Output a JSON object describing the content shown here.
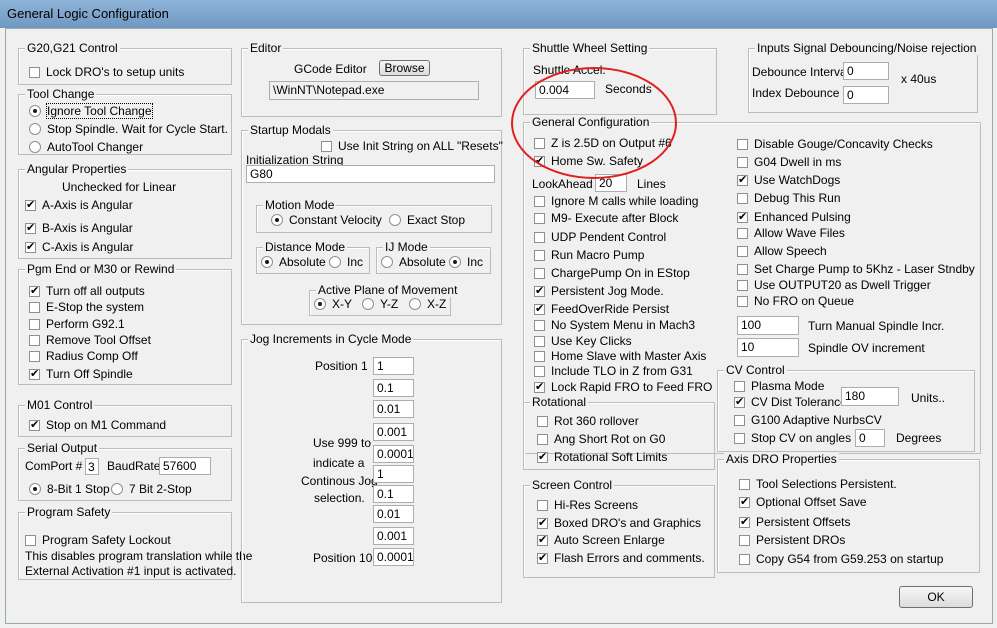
{
  "window": {
    "title": "General Logic Configuration"
  },
  "g20": {
    "title": "G20,G21 Control",
    "lock_dro": {
      "label": "Lock DRO's to setup units",
      "checked": false
    }
  },
  "tool_change": {
    "title": "Tool Change",
    "options": [
      "Ignore Tool Change",
      "Stop Spindle. Wait for Cycle Start.",
      "AutoTool Changer"
    ],
    "selected": 0
  },
  "angular": {
    "title": "Angular Properties",
    "note": "Unchecked for Linear",
    "a": "A-Axis is Angular",
    "b": "B-Axis is Angular",
    "c": "C-Axis is Angular"
  },
  "pgm_end": {
    "title": "Pgm End or M30 or Rewind",
    "items": [
      "Turn off all outputs",
      "E-Stop the system",
      "Perform G92.1",
      "Remove Tool Offset",
      "Radius Comp Off",
      "Turn Off Spindle"
    ]
  },
  "m01": {
    "title": "M01 Control",
    "stop": "Stop on M1 Command"
  },
  "serial": {
    "title": "Serial Output",
    "comport_label": "ComPort #",
    "comport": "3",
    "baud_label": "BaudRate",
    "baud": "57600",
    "opt1": "8-Bit 1 Stop",
    "opt2": "7 Bit 2-Stop"
  },
  "safety": {
    "title": "Program Safety",
    "lockout": "Program Safety Lockout",
    "desc1": "This disables program translation while the",
    "desc2": "External Activation #1 input is activated."
  },
  "editor": {
    "title": "Editor",
    "label": "GCode Editor",
    "browse": "Browse",
    "path": "\\WinNT\\Notepad.exe"
  },
  "startup": {
    "title": "Startup Modals",
    "use_init": "Use Init String on ALL  \"Resets\"",
    "init_label": "Initialization String",
    "init_value": "G80",
    "motion_title": "Motion Mode",
    "constant_velocity": "Constant Velocity",
    "exact_stop": "Exact Stop",
    "distance_title": "Distance Mode",
    "ij_title": "IJ Mode",
    "absolute": "Absolute",
    "inc": "Inc",
    "plane_title": "Active Plane of Movement",
    "xy": "X-Y",
    "yz": "Y-Z",
    "xz": "X-Z"
  },
  "jog": {
    "title": "Jog Increments in Cycle Mode",
    "pos1": "Position 1",
    "pos10": "Position 10",
    "note": [
      "Use 999 to",
      "indicate a",
      "Continous Jog",
      "selection."
    ],
    "values": [
      "1",
      "0.1",
      "0.01",
      "0.001",
      "0.0001",
      "1",
      "0.1",
      "0.01",
      "0.001",
      "0.0001"
    ]
  },
  "shuttle": {
    "title": "Shuttle Wheel Setting",
    "accel_label": "Shuttle Accel.",
    "accel_value": "0.004",
    "seconds": "Seconds"
  },
  "debounce": {
    "title": "Inputs Signal Debouncing/Noise rejection",
    "interval_label": "Debounce Interval",
    "interval": "0",
    "units": "x 40us",
    "index_label": "Index Debounce",
    "index": "0"
  },
  "general": {
    "title": "General Configuration",
    "left": [
      {
        "label": "Z is 2.5D on Output #6",
        "checked": false
      },
      {
        "label": "Home Sw. Safety",
        "checked": true
      },
      {
        "label": "Ignore M calls while loading",
        "checked": false
      },
      {
        "label": "M9- Execute after Block",
        "checked": false
      },
      {
        "label": "UDP Pendent Control",
        "checked": false
      },
      {
        "label": "Run Macro Pump",
        "checked": false
      },
      {
        "label": "ChargePump On in EStop",
        "checked": false
      },
      {
        "label": "Persistent Jog Mode.",
        "checked": true
      },
      {
        "label": "FeedOverRide Persist",
        "checked": true
      },
      {
        "label": "No System Menu in Mach3",
        "checked": false
      },
      {
        "label": "Use Key Clicks",
        "checked": false
      },
      {
        "label": "Home Slave with Master Axis",
        "checked": false
      },
      {
        "label": "Include TLO in Z from G31",
        "checked": false
      },
      {
        "label": "Lock Rapid FRO to Feed FRO",
        "checked": true
      }
    ],
    "lookahead_label": "LookAhead",
    "lookahead": "20",
    "lines": "Lines",
    "right": [
      {
        "label": "Disable Gouge/Concavity Checks",
        "checked": false
      },
      {
        "label": "G04 Dwell in ms",
        "checked": false
      },
      {
        "label": "Use WatchDogs",
        "checked": true
      },
      {
        "label": "Debug This Run",
        "checked": false
      },
      {
        "label": "Enhanced Pulsing",
        "checked": true
      },
      {
        "label": "Allow Wave Files",
        "checked": false
      },
      {
        "label": "Allow Speech",
        "checked": false
      },
      {
        "label": "Set Charge Pump to 5Khz  - Laser Stndby",
        "checked": false
      },
      {
        "label": "Use OUTPUT20 as Dwell Trigger",
        "checked": false
      },
      {
        "label": "No FRO on Queue",
        "checked": false
      }
    ],
    "turn_manual_value": "100",
    "turn_manual_label": "Turn Manual Spindle Incr.",
    "spindle_ov_value": "10",
    "spindle_ov_label": "Spindle OV increment"
  },
  "rotational": {
    "title": "Rotational",
    "items": [
      {
        "label": "Rot 360 rollover",
        "checked": false
      },
      {
        "label": "Ang Short Rot on G0",
        "checked": false
      },
      {
        "label": "Rotational Soft Limits",
        "checked": true
      }
    ]
  },
  "screen": {
    "title": "Screen Control",
    "items": [
      {
        "label": "Hi-Res Screens",
        "checked": false
      },
      {
        "label": "Boxed DRO's and Graphics",
        "checked": true
      },
      {
        "label": "Auto Screen Enlarge",
        "checked": true
      },
      {
        "label": "Flash Errors and comments.",
        "checked": true
      }
    ]
  },
  "cv": {
    "title": "CV Control",
    "plasma": "Plasma Mode",
    "dist_label": "CV Dist Tolerance",
    "dist_value": "180",
    "units": "Units..",
    "g100": "G100 Adaptive NurbsCV",
    "stop_label": "Stop CV on angles >",
    "stop_value": "0",
    "degrees": "Degrees"
  },
  "axis_dro": {
    "title": "Axis DRO Properties",
    "items": [
      {
        "label": "Tool Selections Persistent.",
        "checked": false
      },
      {
        "label": "Optional Offset Save",
        "checked": true
      },
      {
        "label": "Persistent Offsets",
        "checked": true
      },
      {
        "label": "Persistent DROs",
        "checked": false
      },
      {
        "label": "Copy G54 from G59.253 on startup",
        "checked": false
      }
    ]
  },
  "ok": "OK"
}
